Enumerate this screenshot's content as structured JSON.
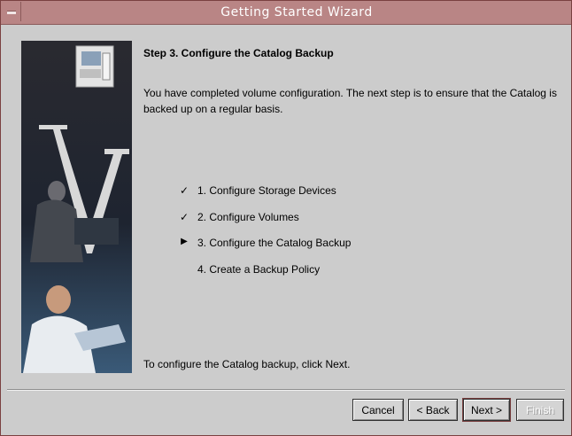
{
  "window": {
    "title": "Getting Started Wizard"
  },
  "step": {
    "title": "Step 3.  Configure the Catalog Backup",
    "description": "You have completed volume configuration.  The next step is to ensure that the Catalog is backed up on a regular basis.",
    "footer": "To configure the Catalog backup, click Next."
  },
  "steps": [
    {
      "mark": "✓",
      "label": "1.  Configure Storage Devices",
      "status": "completed"
    },
    {
      "mark": "✓",
      "label": "2.  Configure Volumes",
      "status": "completed"
    },
    {
      "mark": "▶",
      "label": "3.  Configure the Catalog Backup",
      "status": "current"
    },
    {
      "mark": "",
      "label": "4.  Create a Backup Policy",
      "status": "pending"
    }
  ],
  "buttons": {
    "cancel": "Cancel",
    "back": "< Back",
    "next": "Next >",
    "finish": "Finish"
  },
  "colors": {
    "titlebar": "#b98585",
    "background": "#cccccc"
  }
}
